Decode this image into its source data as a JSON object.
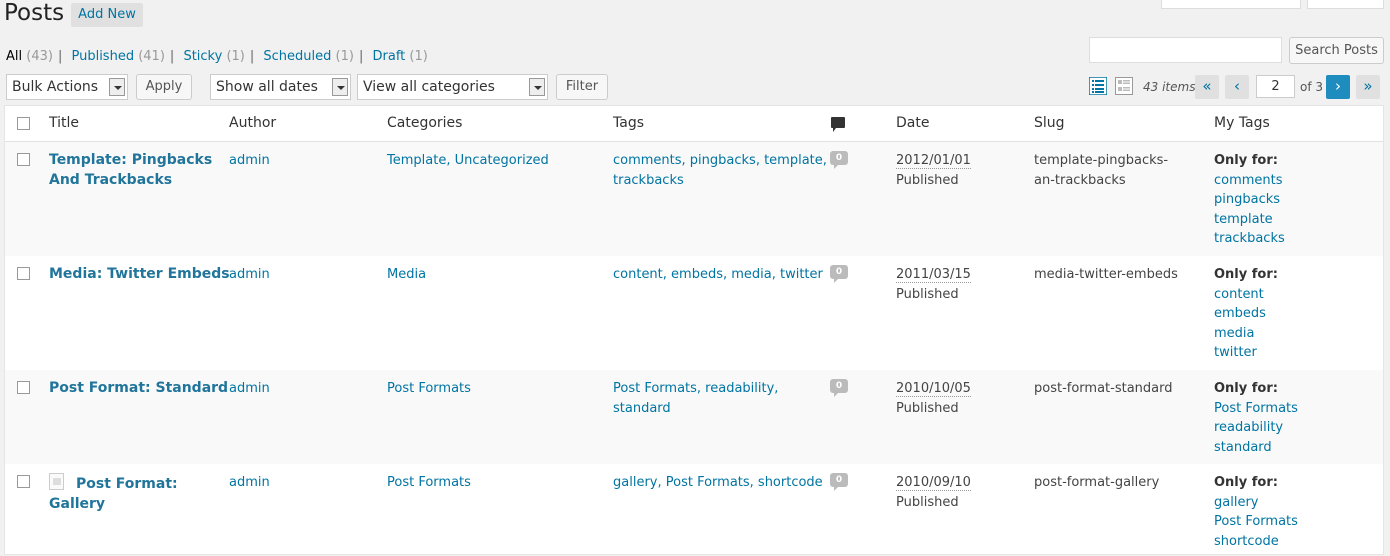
{
  "header": {
    "title": "Posts",
    "add_new": "Add New"
  },
  "views": [
    {
      "label": "All",
      "count": "(43)"
    },
    {
      "label": "Published",
      "count": "(41)"
    },
    {
      "label": "Sticky",
      "count": "(1)"
    },
    {
      "label": "Scheduled",
      "count": "(1)"
    },
    {
      "label": "Draft",
      "count": "(1)"
    }
  ],
  "search": {
    "value": "",
    "button": "Search Posts"
  },
  "tablenav": {
    "bulk_actions": "Bulk Actions",
    "apply": "Apply",
    "dates": "Show all dates",
    "categories": "View all categories",
    "filter": "Filter",
    "items": "43 items",
    "first": "«",
    "prev": "‹",
    "current_page": "2",
    "of_pages": "of 3",
    "next": "›",
    "last": "»"
  },
  "columns": {
    "title": "Title",
    "author": "Author",
    "categories": "Categories",
    "tags": "Tags",
    "date": "Date",
    "slug": "Slug",
    "my_tags": "My Tags"
  },
  "rows": [
    {
      "title_l1": "Template: Pingbacks",
      "title_l2": "And Trackbacks",
      "author": "admin",
      "categories": "Template, Uncategorized",
      "tags_l1": "comments, pingbacks, template,",
      "tags_l2": "trackbacks",
      "comments": "0",
      "date": "2012/01/01",
      "status": "Published",
      "slug_l1": "template-pingbacks-",
      "slug_l2": "an-trackbacks",
      "only_for": "Only for:",
      "my_tags": [
        "comments",
        "pingbacks",
        "template",
        "trackbacks"
      ]
    },
    {
      "title_l1": "Media: Twitter Embeds",
      "title_l2": "",
      "author": "admin",
      "categories": "Media",
      "tags_l1": "content, embeds, media, twitter",
      "tags_l2": "",
      "comments": "0",
      "date": "2011/03/15",
      "status": "Published",
      "slug_l1": "media-twitter-embeds",
      "slug_l2": "",
      "only_for": "Only for:",
      "my_tags": [
        "content",
        "embeds",
        "media",
        "twitter"
      ]
    },
    {
      "title_l1": "Post Format: Standard",
      "title_l2": "",
      "author": "admin",
      "categories": "Post Formats",
      "tags_l1": "Post Formats, readability,",
      "tags_l2": "standard",
      "comments": "0",
      "date": "2010/10/05",
      "status": "Published",
      "slug_l1": "post-format-standard",
      "slug_l2": "",
      "only_for": "Only for:",
      "my_tags": [
        "Post Formats",
        "readability",
        "standard"
      ]
    },
    {
      "title_l1": "Post Format:",
      "title_l2": "Gallery",
      "author": "admin",
      "categories": "Post Formats",
      "tags_l1": "gallery, Post Formats, shortcode",
      "tags_l2": "",
      "comments": "0",
      "date": "2010/09/10",
      "status": "Published",
      "slug_l1": "post-format-gallery",
      "slug_l2": "",
      "only_for": "Only for:",
      "my_tags": [
        "gallery",
        "Post Formats",
        "shortcode"
      ]
    }
  ]
}
